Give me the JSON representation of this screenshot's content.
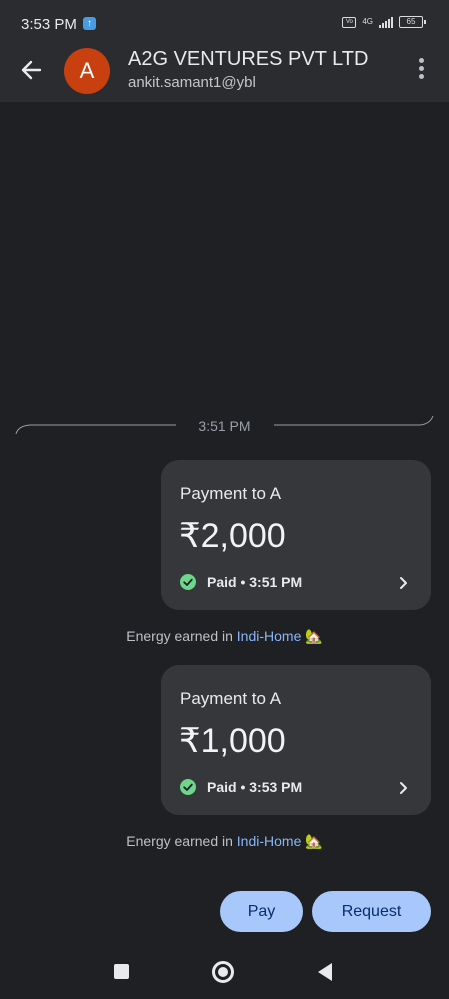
{
  "status_bar": {
    "time": "3:53 PM",
    "network": "4G",
    "battery": "65"
  },
  "header": {
    "avatar_letter": "A",
    "title": "A2G VENTURES PVT LTD",
    "subtitle": "ankit.samant1@ybl"
  },
  "conversation": {
    "divider_time": "3:51 PM",
    "payments": [
      {
        "title": "Payment to A",
        "amount": "₹2,000",
        "status": "Paid • 3:51 PM",
        "energy_prefix": "Energy earned in ",
        "energy_link": "Indi-Home",
        "energy_emoji": "🏡"
      },
      {
        "title": "Payment to A",
        "amount": "₹1,000",
        "status": "Paid • 3:53 PM",
        "energy_prefix": "Energy earned in ",
        "energy_link": "Indi-Home",
        "energy_emoji": "🏡"
      }
    ]
  },
  "actions": {
    "pay_label": "Pay",
    "request_label": "Request"
  },
  "colors": {
    "background": "#1f2023",
    "card": "#36373a",
    "accent_button": "#a8c7fa",
    "avatar": "#c8400f",
    "paid_check": "#6dd58c",
    "link": "#8ab4f8"
  }
}
